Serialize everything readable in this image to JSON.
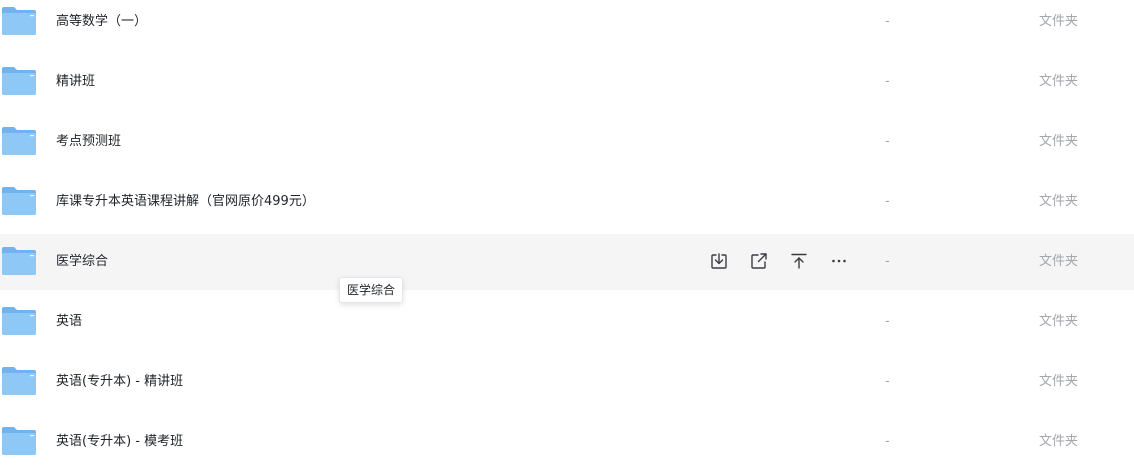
{
  "colors": {
    "folder_back": "#6fb3ef",
    "folder_front": "#8ec8f7",
    "hover_row": "#f5f5f6",
    "text": "#1f2329",
    "muted": "#a3a6ad"
  },
  "rows": [
    {
      "name": "高等数学（一）",
      "size": "-",
      "type": "文件夹"
    },
    {
      "name": "精讲班",
      "size": "-",
      "type": "文件夹"
    },
    {
      "name": "考点预测班",
      "size": "-",
      "type": "文件夹"
    },
    {
      "name": "库课专升本英语课程讲解（官网原价499元）",
      "size": "-",
      "type": "文件夹"
    },
    {
      "name": "医学综合",
      "size": "-",
      "type": "文件夹"
    },
    {
      "name": "英语",
      "size": "-",
      "type": "文件夹"
    },
    {
      "name": "英语(专升本) - 精讲班",
      "size": "-",
      "type": "文件夹"
    },
    {
      "name": "英语(专升本) - 模考班",
      "size": "-",
      "type": "文件夹"
    }
  ],
  "hover_actions": [
    {
      "icon": "download-icon"
    },
    {
      "icon": "share-icon"
    },
    {
      "icon": "move-to-top-icon"
    },
    {
      "icon": "more-icon"
    }
  ],
  "tooltip": {
    "text": "医学综合"
  }
}
